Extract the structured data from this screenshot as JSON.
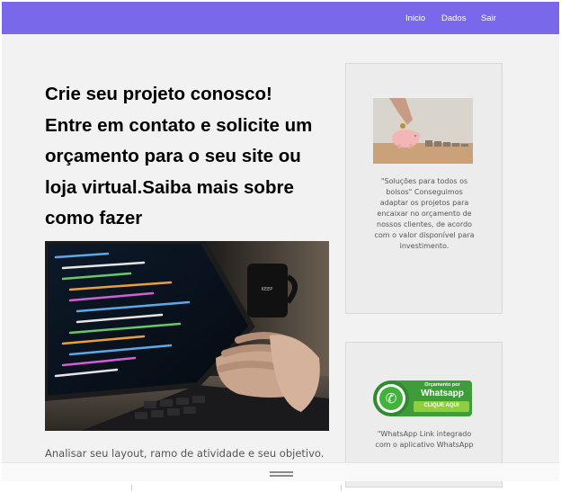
{
  "nav": {
    "items": [
      {
        "label": "Inicio"
      },
      {
        "label": "Dados"
      },
      {
        "label": "Sair"
      }
    ],
    "color": "#7a68ea"
  },
  "main": {
    "headline": "Crie seu projeto conosco! Entre em contato e solicite um orçamento para o seu site ou loja virtual.Saiba mais sobre como fazer",
    "intro": "Analisar seu layout, ramo de atividade e seu objetivo."
  },
  "sidebar": {
    "card1": {
      "text": "\"Soluções para todos os bolsos\" Conseguimos adaptar os projetos para encaixar no orçamento de nossos clientes, de acordo com o valor disponível para investimento."
    },
    "card2": {
      "badge_line1": "Orçamento por",
      "badge_line2": "Whatsapp",
      "badge_button": "CLIQUE AQUI",
      "text": "\"WhatsApp Link integrado com o aplicativo WhatsApp"
    }
  }
}
